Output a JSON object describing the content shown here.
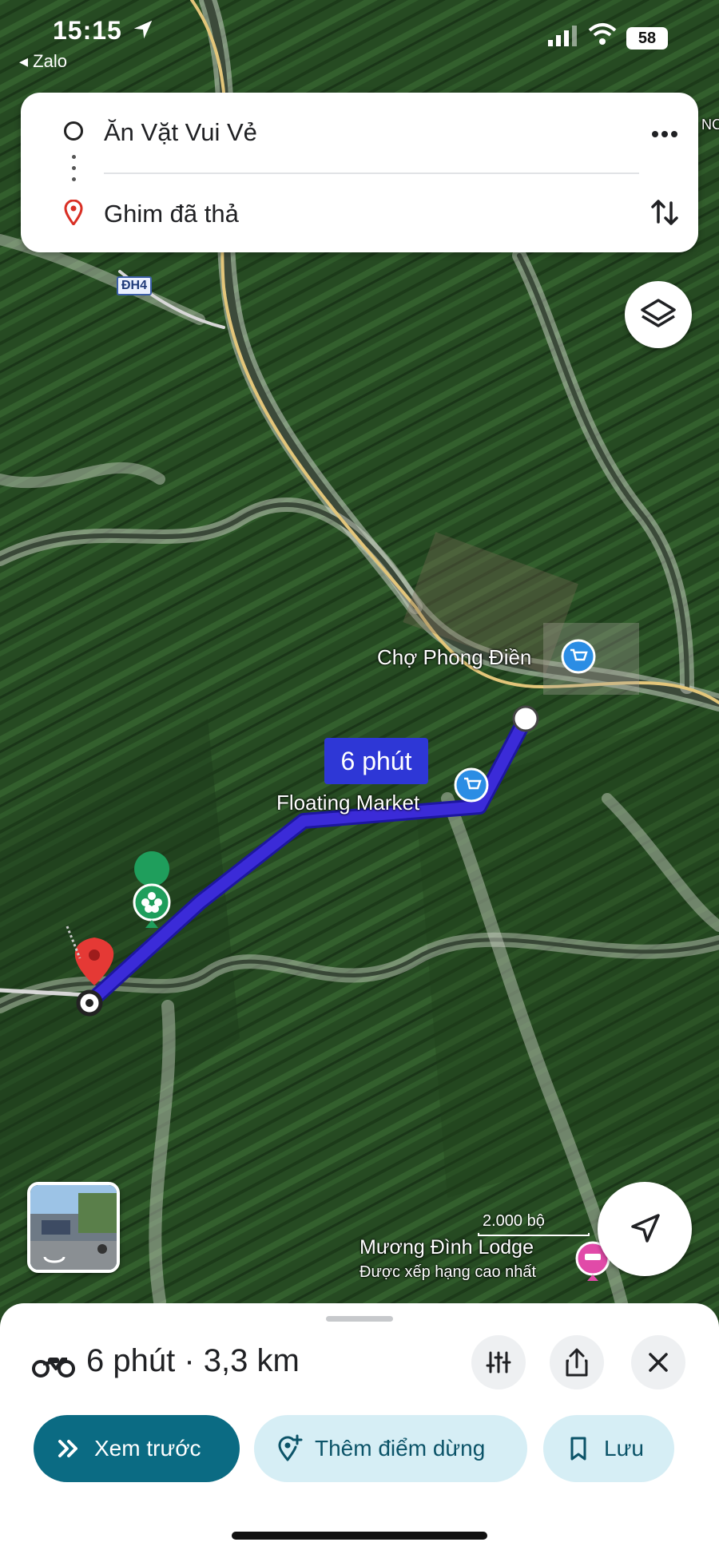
{
  "status_bar": {
    "time": "15:15",
    "back_app": "◂ Zalo",
    "battery": "58"
  },
  "directions": {
    "origin": "Ăn Vặt Vui Vẻ",
    "destination": "Ghim đã thả",
    "more_icon": "more-horizontal-icon",
    "swap_icon": "swap-vertical-icon"
  },
  "map": {
    "road_badge": "ĐH4",
    "places": {
      "market": "Chợ Phong Điền",
      "floating_market": "Floating Market",
      "lodge": "Mương Đình Lodge",
      "lodge_sub": "Được xếp hạng cao nhất"
    },
    "route_eta": "6 phút",
    "scale_label": "2.000 bộ",
    "corner_text": "NC",
    "colors": {
      "route": "#3b2bd8",
      "route_label_bg": "#2e37d6",
      "market_pin": "#2b8de4",
      "lodge_pin": "#e14aa8",
      "dest_pin": "#e53935",
      "park_pin": "#1f9e5c"
    }
  },
  "sheet": {
    "summary": "6 phút · 3,3 km",
    "buttons": {
      "preview": "Xem trước",
      "add_stop": "Thêm điểm dừng",
      "save": "Lưu"
    },
    "colors": {
      "primary": "#0b6b83",
      "secondary_bg": "#d6eef5"
    }
  }
}
